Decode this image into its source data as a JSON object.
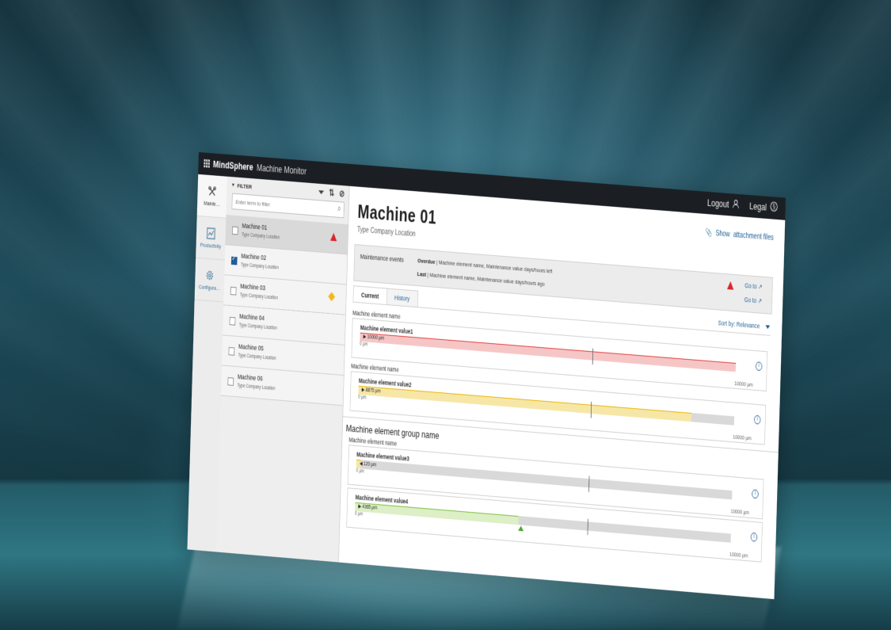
{
  "topbar": {
    "brand": "MindSphere",
    "app_title": "Machine Monitor",
    "logout": "Logout",
    "legal": "Legal"
  },
  "rail": [
    {
      "label": "Mainte…",
      "icon": "wrench-icon"
    },
    {
      "label": "Productivity",
      "icon": "chart-icon"
    },
    {
      "label": "Configura…",
      "icon": "gear-icon"
    }
  ],
  "filter": {
    "title": "FILTER",
    "placeholder": "Enter term to filter"
  },
  "machines": [
    {
      "name": "Machine 01",
      "sub": "Type Company Location",
      "checked": false,
      "status": "error"
    },
    {
      "name": "Machine 02",
      "sub": "Type Company Location",
      "checked": true,
      "status": "none"
    },
    {
      "name": "Machine 03",
      "sub": "Type Company Location",
      "checked": false,
      "status": "warning"
    },
    {
      "name": "Machine 04",
      "sub": "Type Company Location",
      "checked": false,
      "status": "none"
    },
    {
      "name": "Machine 05",
      "sub": "Type Company Location",
      "checked": false,
      "status": "none"
    },
    {
      "name": "Machine 06",
      "sub": "Type Company Location",
      "checked": false,
      "status": "none"
    }
  ],
  "main": {
    "title": "Machine 01",
    "subtitle": "Type Company Location",
    "attach_show": "Show",
    "attach_files": "attachment files",
    "events": {
      "label": "Maintenance events",
      "overdue_label": "Overdue",
      "overdue_text": "| Machine element name, Maintenance value days/hours left",
      "last_label": "Last",
      "last_text": "| Machine element name, Maintenance value days/hours ago",
      "goto": "Go to"
    },
    "tabs": [
      "Current",
      "History"
    ],
    "sort_label": "Sort by:",
    "sort_value": "Relevance",
    "group_title": "Machine element group name",
    "section_label": "Machine element name",
    "zero_label": "0 µm",
    "max_label": "10000 µm",
    "elements": [
      {
        "title": "Machine element value1",
        "value": "10000 µm",
        "fill_fraction": 1.0,
        "color": "#e23b3b",
        "bg": "#f6c6c6",
        "marker": "right"
      },
      {
        "title": "Machine element value2",
        "value": "8875 µm",
        "fill_fraction": 0.8875,
        "color": "#e8b400",
        "bg": "#f7e7a6",
        "marker": "right"
      },
      {
        "title": "Machine element value3",
        "value": "120 µm",
        "fill_fraction": 0.012,
        "color": "#e8b400",
        "bg": "#f7e7a6",
        "marker": "left"
      },
      {
        "title": "Machine element value4",
        "value": "4365 µm",
        "fill_fraction": 0.4365,
        "color": "#7bbd3b",
        "bg": "#dcefc6",
        "marker": "triangle"
      }
    ]
  }
}
